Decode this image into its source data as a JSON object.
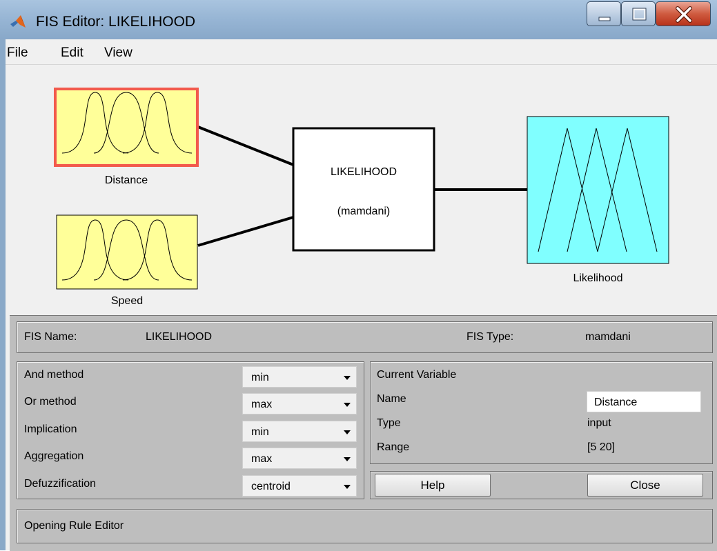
{
  "window": {
    "title": "FIS Editor: LIKELIHOOD"
  },
  "menu": {
    "file": "File",
    "edit": "Edit",
    "view": "View"
  },
  "diagram": {
    "inputs": [
      {
        "label": "Distance",
        "selected": true
      },
      {
        "label": "Speed",
        "selected": false
      }
    ],
    "system": {
      "name": "LIKELIHOOD",
      "type_label": "(mamdani)"
    },
    "output": {
      "label": "Likelihood"
    },
    "colors": {
      "input_fill": "#ffff99",
      "output_fill": "#80ffff",
      "selection": "#f25a4c"
    }
  },
  "fis": {
    "name_label": "FIS Name:",
    "name_value": "LIKELIHOOD",
    "type_label": "FIS Type:",
    "type_value": "mamdani"
  },
  "methods": [
    {
      "label": "And method",
      "value": "min"
    },
    {
      "label": "Or method",
      "value": "max"
    },
    {
      "label": "Implication",
      "value": "min"
    },
    {
      "label": "Aggregation",
      "value": "max"
    },
    {
      "label": "Defuzzification",
      "value": "centroid"
    }
  ],
  "current_variable": {
    "heading": "Current Variable",
    "name_label": "Name",
    "name_value": "Distance",
    "type_label": "Type",
    "type_value": "input",
    "range_label": "Range",
    "range_value": "[5 20]"
  },
  "buttons": {
    "help": "Help",
    "close": "Close"
  },
  "status": "Opening Rule Editor"
}
